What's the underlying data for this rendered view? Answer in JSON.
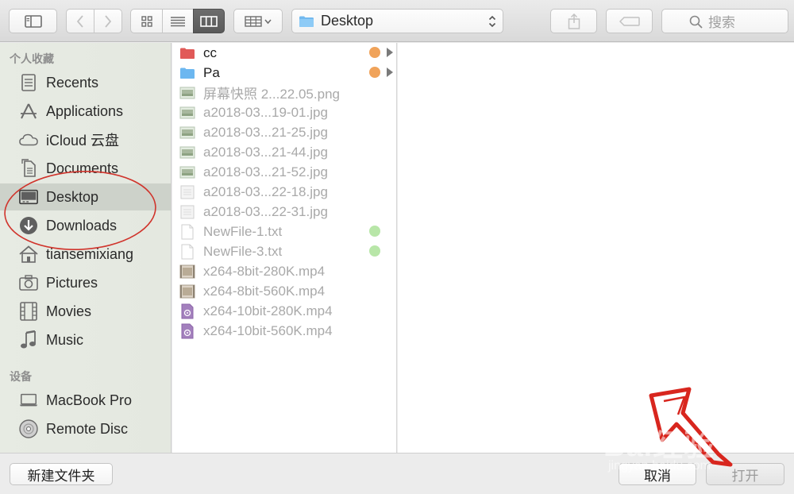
{
  "toolbar": {
    "path_label": "Desktop",
    "search_placeholder": "搜索"
  },
  "sidebar": {
    "favorites_header": "个人收藏",
    "devices_header": "设备",
    "favorites": [
      {
        "label": "Recents",
        "icon": "recents-icon"
      },
      {
        "label": "Applications",
        "icon": "applications-icon"
      },
      {
        "label": "iCloud 云盘",
        "icon": "icloud-icon"
      },
      {
        "label": "Documents",
        "icon": "documents-icon"
      },
      {
        "label": "Desktop",
        "icon": "desktop-icon",
        "selected": true
      },
      {
        "label": "Downloads",
        "icon": "downloads-icon"
      },
      {
        "label": "tiansemixiang",
        "icon": "home-icon"
      },
      {
        "label": "Pictures",
        "icon": "pictures-icon"
      },
      {
        "label": "Movies",
        "icon": "movies-icon"
      },
      {
        "label": "Music",
        "icon": "music-icon"
      }
    ],
    "devices": [
      {
        "label": "MacBook Pro",
        "icon": "laptop-icon"
      },
      {
        "label": "Remote Disc",
        "icon": "disc-icon"
      }
    ]
  },
  "files": [
    {
      "name": "cc",
      "type": "folder",
      "color": "#e05a58",
      "enabled": true,
      "tag": "#f0a35a",
      "has_children": true
    },
    {
      "name": "Pa",
      "type": "folder",
      "color": "#6cb7f0",
      "enabled": true,
      "tag": "#f0a35a",
      "has_children": true
    },
    {
      "name": "屏幕快照 2...22.05.png",
      "type": "image",
      "enabled": false
    },
    {
      "name": "a2018-03...19-01.jpg",
      "type": "image",
      "enabled": false
    },
    {
      "name": "a2018-03...21-25.jpg",
      "type": "image",
      "enabled": false
    },
    {
      "name": "a2018-03...21-44.jpg",
      "type": "image",
      "enabled": false
    },
    {
      "name": "a2018-03...21-52.jpg",
      "type": "image",
      "enabled": false
    },
    {
      "name": "a2018-03...22-18.jpg",
      "type": "image-light",
      "enabled": false
    },
    {
      "name": "a2018-03...22-31.jpg",
      "type": "image-light",
      "enabled": false
    },
    {
      "name": "NewFile-1.txt",
      "type": "text",
      "enabled": false,
      "tag": "#b8e6a8"
    },
    {
      "name": "NewFile-3.txt",
      "type": "text",
      "enabled": false,
      "tag": "#b8e6a8"
    },
    {
      "name": "x264-8bit-280K.mp4",
      "type": "video",
      "enabled": false
    },
    {
      "name": "x264-8bit-560K.mp4",
      "type": "video",
      "enabled": false
    },
    {
      "name": "x264-10bit-280K.mp4",
      "type": "media",
      "enabled": false
    },
    {
      "name": "x264-10bit-560K.mp4",
      "type": "media",
      "enabled": false
    }
  ],
  "bottom": {
    "new_folder_label": "新建文件夹",
    "cancel_label": "取消",
    "open_label": "打开"
  },
  "watermark": {
    "main": "Bai经验",
    "sub": "jingyan.baidu.com"
  }
}
